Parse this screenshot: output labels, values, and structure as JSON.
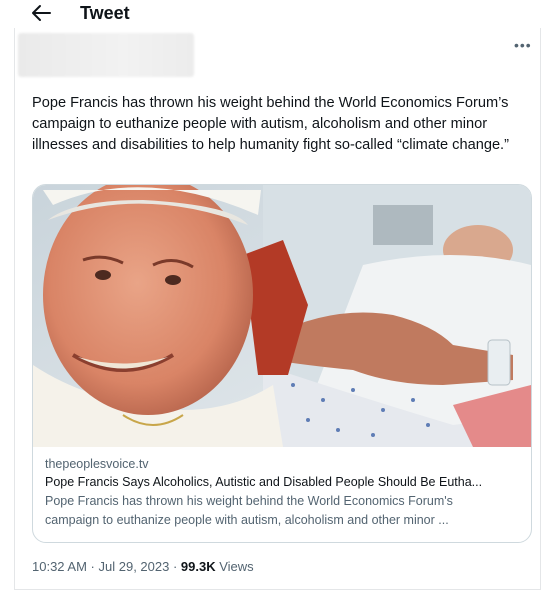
{
  "header": {
    "title": "Tweet"
  },
  "tweet": {
    "text": "Pope Francis has thrown his weight behind the World Economics Forum’s campaign to euthanize people with autism, alcoholism and other minor illnesses and disabilities to help humanity fight so-called “climate change.”"
  },
  "card": {
    "domain": "thepeoplesvoice.tv",
    "title": "Pope Francis Says Alcoholics, Autistic and Disabled People Should Be Eutha...",
    "description_line1": "Pope Francis has thrown his weight behind the World Economics Forum's",
    "description_line2": "campaign to euthanize people with autism, alcoholism and other minor ..."
  },
  "footer": {
    "time": "10:32 AM",
    "sep1": " · ",
    "date": "Jul 29, 2023",
    "sep2": " · ",
    "views_count": "99.3K",
    "views_label": " Views"
  },
  "icons": {
    "back": "arrow-left-icon",
    "more": "more-horizontal-icon"
  }
}
